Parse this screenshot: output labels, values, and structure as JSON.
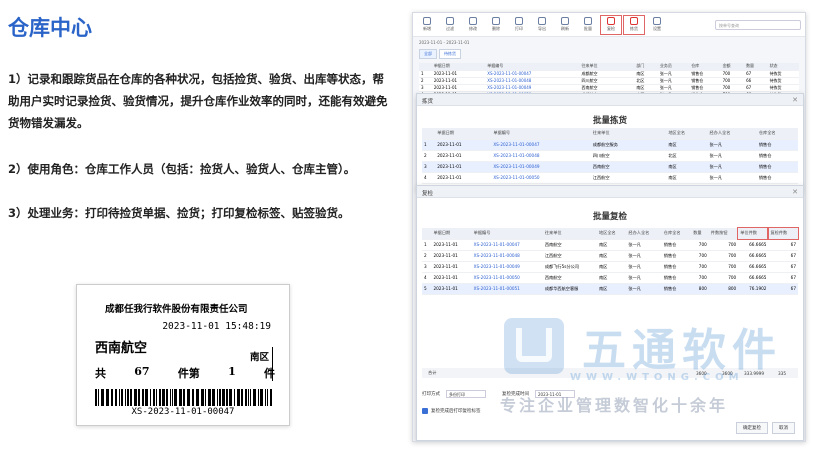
{
  "page": {
    "title": "仓库中心",
    "para1": "1）记录和跟踪货品在仓库的各种状况，包括捡货、验货、出库等状态，帮助用户实时记录捡货、验货情况，提升仓库作业效率的同时，还能有效避免货物错发漏发。",
    "para2": "2）使用角色：仓库工作人员（包括：捡货人、验货人、仓库主管）。",
    "para3": "3）处理业务：打印待捡货单据、捡货；打印复检标签、贴签验货。"
  },
  "label": {
    "company": "成都任我行软件股份有限责任公司",
    "datetime": "2023-11-01 15:48:19",
    "customer": "西南航空",
    "region": "南区",
    "total_prefix": "共",
    "total_qty": "67",
    "total_unit": "件第",
    "piece_no": "1",
    "piece_unit": "件",
    "barcode_text": "XS-2023-11-01-00047"
  },
  "app": {
    "toolbar": [
      "新增",
      "过滤",
      "修改",
      "删除",
      "打印",
      "导出",
      "刷新",
      "批量",
      "复检",
      "拣货",
      "设置"
    ],
    "search_placeholder": "按单号查询",
    "date_range": "2023-11-01 - 2023-11-01",
    "subtabs": [
      "全部",
      "待拣货"
    ],
    "bg_headers": [
      "单据日期",
      "单据编号",
      "往来单位",
      "部门",
      "业务员",
      "仓库",
      "金额",
      "数量",
      "状态"
    ],
    "bg_rows": [
      [
        "2023-11-01",
        "XS-2023-11-01-00047",
        "成都航空",
        "南区",
        "张一凡",
        "销售仓",
        "700",
        "67",
        "待拣货"
      ],
      [
        "2023-11-01",
        "XS-2023-11-01-00048",
        "四川航空",
        "北区",
        "张一凡",
        "销售仓",
        "700",
        "66",
        "待拣货"
      ],
      [
        "2023-11-01",
        "XS-2023-11-01-00049",
        "西南航空",
        "南区",
        "张一凡",
        "销售仓",
        "700",
        "67",
        "待拣货"
      ],
      [
        "2023-11-01",
        "XS-2023-11-01-00050",
        "成都航空",
        "南区",
        "张一凡",
        "销售仓",
        "700",
        "66",
        "待拣货"
      ],
      [
        "2023-11-01",
        "XS-2023-11-01-00051",
        "成都华西航空",
        "南区",
        "张一凡",
        "销售仓",
        "800",
        "67",
        "待拣货"
      ]
    ]
  },
  "dialog1": {
    "header": "拣货",
    "title": "批量拣货",
    "headers": [
      "单据日期",
      "单据编号",
      "往来单位",
      "地区全名",
      "经办人全名",
      "仓库全名"
    ],
    "rows": [
      [
        "2023-11-01",
        "XS-2023-11-01-00047",
        "成都航空服务",
        "南区",
        "张一凡",
        "销售仓"
      ],
      [
        "2023-11-01",
        "XS-2023-11-01-00048",
        "四川航空",
        "北区",
        "张一凡",
        "销售仓"
      ],
      [
        "2023-11-01",
        "XS-2023-11-01-00049",
        "西南航空",
        "南区",
        "张一凡",
        "销售仓"
      ],
      [
        "2023-11-01",
        "XS-2023-11-01-00050",
        "江西航空",
        "南区",
        "张一凡",
        "销售仓"
      ],
      [
        "2023-11-01",
        "XS-2023-11-01-00051",
        "成都飞行5s分公司",
        "南区",
        "张一凡",
        "销售仓"
      ]
    ]
  },
  "dialog2": {
    "header": "复检",
    "title": "批量复检",
    "headers": [
      "单据日期",
      "单据编号",
      "往来单位",
      "地区全名",
      "经办人全名",
      "仓库全名",
      "数量",
      "件数按钮",
      "单位件数",
      "复检件数"
    ],
    "rows": [
      [
        "2023-11-01",
        "XS-2023-11-01-00047",
        "西南航空",
        "南区",
        "张一凡",
        "销售仓",
        "700",
        "700",
        "66.6665",
        "67"
      ],
      [
        "2023-11-01",
        "XS-2023-11-01-00048",
        "江西航空",
        "南区",
        "张一凡",
        "销售仓",
        "700",
        "700",
        "66.6665",
        "67"
      ],
      [
        "2023-11-01",
        "XS-2023-11-01-00049",
        "成都飞行5s分公司",
        "南区",
        "张一凡",
        "销售仓",
        "700",
        "700",
        "66.6665",
        "67"
      ],
      [
        "2023-11-01",
        "XS-2023-11-01-00050",
        "西南航空",
        "南区",
        "张一凡",
        "销售仓",
        "700",
        "700",
        "66.6665",
        "67"
      ],
      [
        "2023-11-01",
        "XS-2023-11-01-00051",
        "成都华西航空客服",
        "南区",
        "张一凡",
        "销售仓",
        "800",
        "800",
        "76.1902",
        "67"
      ]
    ],
    "total_label": "合计",
    "total_qty": "3600",
    "total_pcs": "3600",
    "total_unit": "333.9999",
    "total_check": "335",
    "option_label": "打印方式",
    "option_value": "多份打印",
    "date_label": "复检完成时间",
    "date_value": "2023-11-01",
    "checkbox_label": "复检完成后打印复检标签",
    "btn_ok": "确定复检",
    "btn_cancel": "取消"
  },
  "watermark": {
    "name": "五通软件",
    "url": "WWW.WTONG.COM",
    "slogan": "专注企业管理数智化十余年"
  }
}
